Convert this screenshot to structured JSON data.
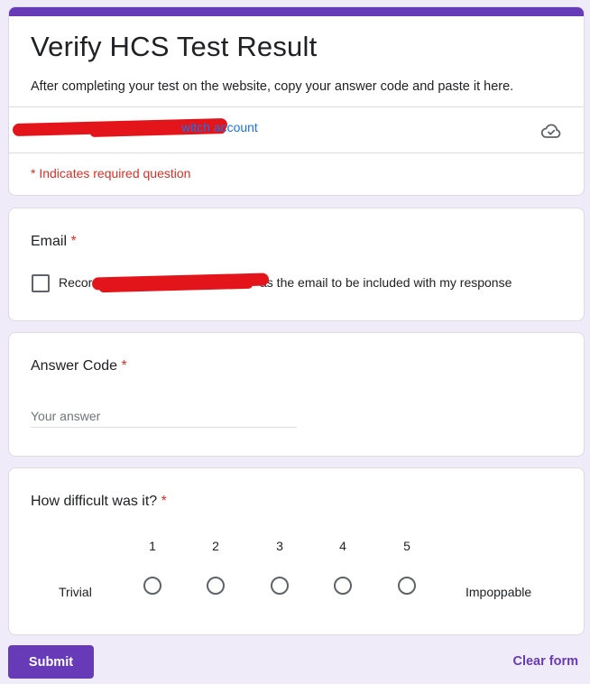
{
  "colors": {
    "accent": "#673ab7",
    "background": "#f0ebf8",
    "required": "#d93025",
    "link": "#1a73e8",
    "redaction": "#e3151a"
  },
  "header": {
    "title": "Verify HCS Test Result",
    "description": "After completing your test on the website, copy your answer code and paste it here.",
    "switch_account": "witch account",
    "cloud_icon": "cloud-check-icon",
    "required_note": "* Indicates required question"
  },
  "email_question": {
    "title": "Email",
    "required_mark": "*",
    "checkbox_prefix": "Record",
    "checkbox_suffix": "as the email to be included with my response",
    "checked": false
  },
  "answer_code": {
    "title": "Answer Code",
    "required_mark": "*",
    "placeholder": "Your answer",
    "value": ""
  },
  "difficulty": {
    "title": "How difficult was it?",
    "required_mark": "*",
    "scale": [
      "1",
      "2",
      "3",
      "4",
      "5"
    ],
    "low_label": "Trivial",
    "high_label": "Impoppable",
    "selected": null
  },
  "actions": {
    "submit_label": "Submit",
    "clear_label": "Clear form"
  }
}
